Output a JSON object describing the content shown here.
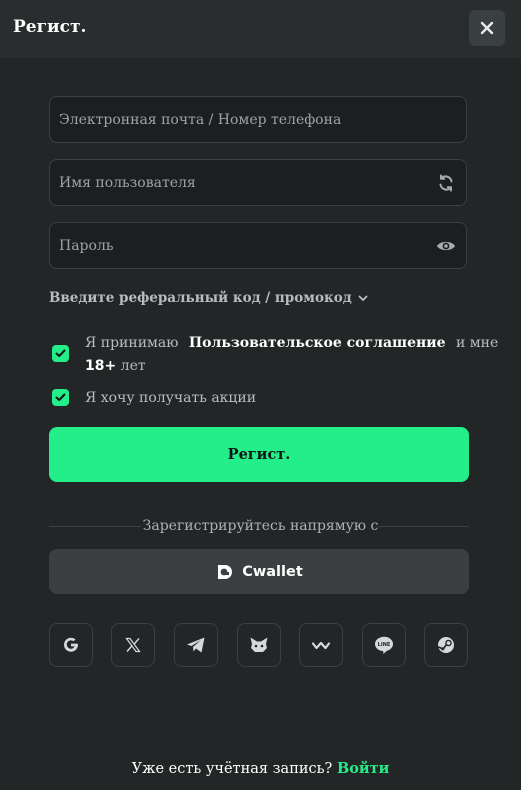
{
  "header": {
    "title": "Регист.",
    "close_icon": "close-icon"
  },
  "form": {
    "email_placeholder": "Электронная почта / Номер телефона",
    "username_placeholder": "Имя пользователя",
    "username_icon": "refresh-icon",
    "password_placeholder": "Пароль",
    "password_icon": "eye-icon",
    "referral_label": "Введите реферальный код / промокод",
    "referral_icon": "chevron-down-icon"
  },
  "agreements": {
    "terms_prefix": "Я принимаю",
    "terms_link": "Пользовательское соглашение",
    "terms_suffix": "и мне",
    "age": "18+",
    "age_suffix": "лет",
    "promo": "Я хочу получать акции",
    "terms_checked": true,
    "promo_checked": true
  },
  "submit_label": "Регист.",
  "divider_text": "Зарегистрируйтесь напрямую с",
  "cwallet_label": "Cwallet",
  "socials": [
    {
      "icon": "google-icon"
    },
    {
      "icon": "x-icon"
    },
    {
      "icon": "telegram-icon"
    },
    {
      "icon": "metamask-icon"
    },
    {
      "icon": "walletconnect-icon"
    },
    {
      "icon": "line-icon"
    },
    {
      "icon": "steam-icon"
    }
  ],
  "footer": {
    "text": "Уже есть учётная запись?",
    "login_link": "Войти"
  },
  "colors": {
    "accent": "#24ee89",
    "background": "#232626",
    "header": "#292d2e"
  }
}
